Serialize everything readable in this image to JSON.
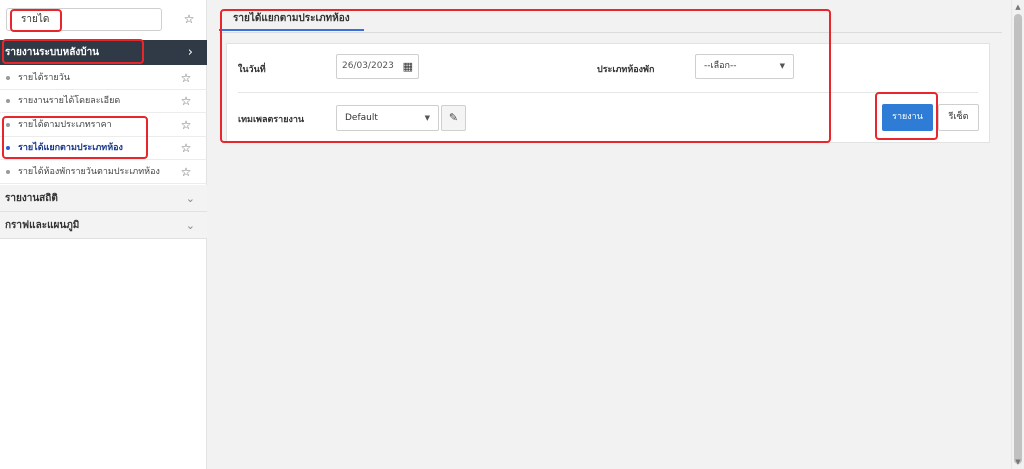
{
  "sidebar": {
    "search_value": "รายได",
    "active_section": {
      "label": "รายงานระบบหลังบ้าน"
    },
    "items": [
      {
        "label": "รายได้รายวัน"
      },
      {
        "label": "รายงานรายได้โดยละเอียด"
      },
      {
        "label": "รายได้ตามประเภทราคา"
      },
      {
        "label": "รายได้แยกตามประเภทห้อง",
        "active": true
      },
      {
        "label": "รายได้ห้องพักรายวันตามประเภทห้อง"
      }
    ],
    "sections": [
      {
        "label": "รายงานสถิติ"
      },
      {
        "label": "กราฟและแผนภูมิ"
      }
    ]
  },
  "main": {
    "tab_label": "รายได้แยกตามประเภทห้อง",
    "form": {
      "date_label": "ในวันที่",
      "date_value": "26/03/2023",
      "room_type_label": "ประเภทห้องพัก",
      "room_type_value": "--เลือก--",
      "template_label": "เทมเพลตรายงาน",
      "template_value": "Default",
      "report_button": "รายงาน",
      "reset_button": "รีเซ็ต"
    }
  },
  "icons": {
    "star": "☆",
    "chevron_right": "›",
    "chevron_down": "⌄",
    "calendar": "📅",
    "caret_down": "▼",
    "edit": "✎"
  },
  "colors": {
    "sidebar_active_bg": "#2f3a46",
    "primary_button": "#2e7cd6",
    "tab_underline": "#3b6fd6",
    "annotation": "#e8262b"
  }
}
